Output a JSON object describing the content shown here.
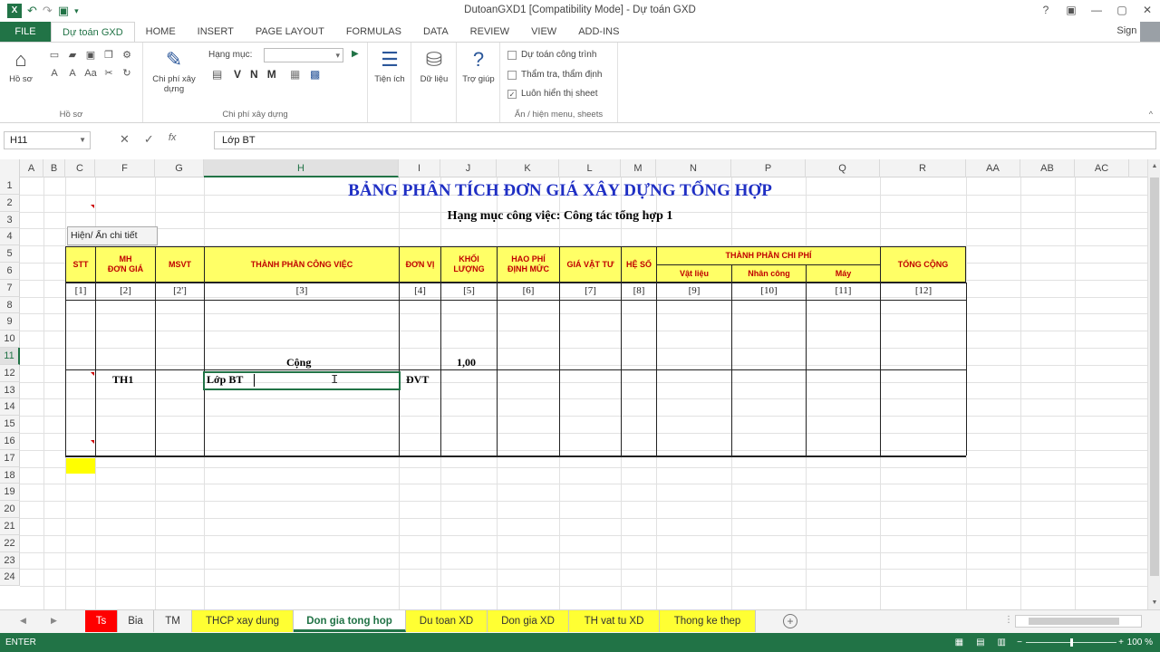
{
  "window": {
    "title": "DutoanGXD1  [Compatibility Mode] - Dự toán GXD",
    "controls": [
      "?",
      "▣",
      "—",
      "▢",
      "✕"
    ]
  },
  "qat_icons": [
    "excel-logo-icon",
    "undo-icon",
    "redo-icon",
    "save-icon",
    "customize-icon"
  ],
  "ribbon_tabs": {
    "file": "FILE",
    "items": [
      "Dự toán GXD",
      "HOME",
      "INSERT",
      "PAGE LAYOUT",
      "FORMULAS",
      "DATA",
      "REVIEW",
      "VIEW",
      "ADD-INS"
    ],
    "active": "Dự toán GXD",
    "signin": "Sign in"
  },
  "ribbon": {
    "ho_so": {
      "btn": "Hồ sơ",
      "label": "Hồ sơ"
    },
    "chi_phi": {
      "btn": "Chi phí xây dựng",
      "label": "Chi phí xây dựng",
      "hang_muc_label": "Hạng mục:",
      "vnm": [
        "V",
        "N",
        "M"
      ]
    },
    "tien_ich": "Tiện ích",
    "du_lieu": "Dữ liệu",
    "tro_giup": "Trợ giúp",
    "options": [
      {
        "label": "Dự toán công trình",
        "checked": false
      },
      {
        "label": "Thẩm tra, thẩm định",
        "checked": false
      },
      {
        "label": "Luôn hiển thị sheet",
        "checked": true
      }
    ],
    "options_label": "Ẩn / hiện menu, sheets"
  },
  "formula_bar": {
    "name_box": "H11",
    "cancel": "✕",
    "enter": "✓",
    "fx": "fx",
    "value": "Lớp BT"
  },
  "grid": {
    "columns": [
      "A",
      "B",
      "C",
      "F",
      "G",
      "H",
      "I",
      "J",
      "K",
      "L",
      "M",
      "N",
      "P",
      "Q",
      "R",
      "AA",
      "AB",
      "AC"
    ],
    "selected_column": "H",
    "rows": [
      "1",
      "2",
      "3",
      "4",
      "5",
      "6",
      "7",
      "8",
      "9",
      "10",
      "11",
      "12",
      "13",
      "14",
      "15",
      "16",
      "17",
      "18",
      "19",
      "20",
      "21",
      "22",
      "23",
      "24"
    ],
    "selected_row": "11"
  },
  "sheet": {
    "title": "BẢNG PHÂN TÍCH ĐƠN GIÁ XÂY DỰNG TỔNG HỢP",
    "subtitle": "Hạng mục công việc: Công tác tổng hợp 1",
    "toggle_button": "Hiện/ Ẩn chi tiết",
    "headers": {
      "stt": "STT",
      "mh": "MH\nĐƠN GIÁ",
      "msvt": "MSVT",
      "thanh_phan": "THÀNH PHẦN CÔNG VIỆC",
      "don_vi": "ĐƠN VỊ",
      "khoi_luong": "KHỐI\nLƯỢNG",
      "hao_phi": "HAO PHÍ\nĐỊNH MỨC",
      "gia_vat_tu": "GIÁ VẬT TƯ",
      "he_so": "HỆ SỐ",
      "thanh_phan_chi_phi": "THÀNH PHẦN CHI PHÍ",
      "vat_lieu": "Vật liệu",
      "nhan_cong": "Nhân công",
      "may": "Máy",
      "tong_cong": "TỔNG CỘNG"
    },
    "indices": [
      "[1]",
      "[2]",
      "[2']",
      "[3]",
      "[4]",
      "[5]",
      "[6]",
      "[7]",
      "[8]",
      "[9]",
      "[10]",
      "[11]",
      "[12]"
    ],
    "row10": {
      "label": "Cộng",
      "value": "1,00"
    },
    "row11": {
      "mh": "TH1",
      "name": "Lớp BT",
      "unit": "ĐVT"
    }
  },
  "sheet_tabs": [
    {
      "label": "Ts",
      "style": "red"
    },
    {
      "label": "Bia",
      "style": "plain"
    },
    {
      "label": "TM",
      "style": "plain"
    },
    {
      "label": "THCP xay dung",
      "style": "yellow"
    },
    {
      "label": "Don gia tong hop",
      "style": "active"
    },
    {
      "label": "Du toan XD",
      "style": "yellow"
    },
    {
      "label": "Don gia XD",
      "style": "yellow"
    },
    {
      "label": "TH vat tu XD",
      "style": "yellow"
    },
    {
      "label": "Thong ke thep",
      "style": "yellow"
    }
  ],
  "status": {
    "mode": "ENTER",
    "zoom": "100 %"
  },
  "colors": {
    "excel_green": "#217346",
    "header_yellow": "#ffff66",
    "header_red_text": "#c00000",
    "title_blue": "#1f2fc4"
  }
}
